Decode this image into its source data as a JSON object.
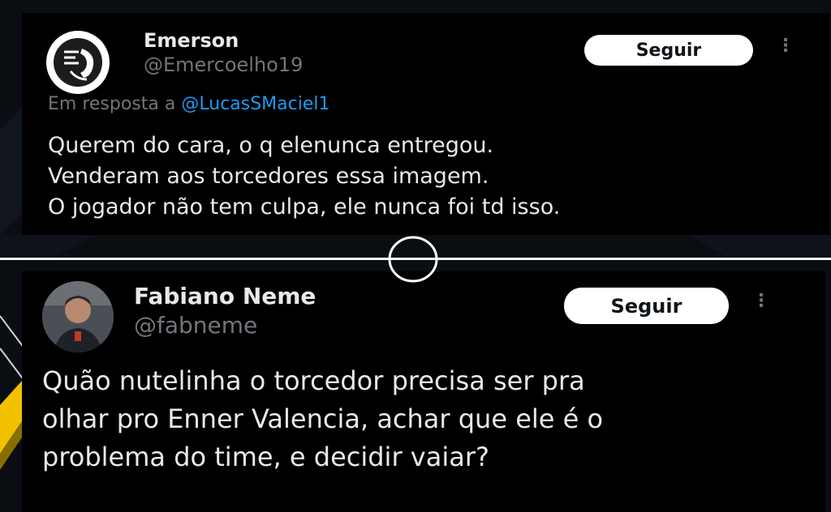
{
  "colors": {
    "page_bg": "#0a0d12",
    "tweet_bg": "#000000",
    "text_primary": "#e7e9ea",
    "text_secondary": "#71767b",
    "link": "#1d9bf0",
    "follow_bg": "#ffffff"
  },
  "tweets": [
    {
      "author_name": "Emerson",
      "author_handle": "@Emercoelho19",
      "avatar_icon": "profile-logo-icon",
      "follow_label": "Seguir",
      "more_icon": "more-options-icon",
      "reply_prefix": "Em resposta a",
      "reply_mention": "@LucasSMaciel1",
      "text": "Querem do cara, o q elenunca entregou.\nVenderam aos torcedores essa imagem.\nO jogador não tem culpa, ele nunca foi td isso."
    },
    {
      "author_name": "Fabiano Neme",
      "author_handle": "@fabneme",
      "avatar_icon": "profile-photo",
      "follow_label": "Seguir",
      "more_icon": "more-options-icon",
      "text": "Quão nutelinha o torcedor precisa ser pra\nolhar pro Enner Valencia, achar que ele é o\nproblema do time, e decidir vaiar?"
    }
  ]
}
